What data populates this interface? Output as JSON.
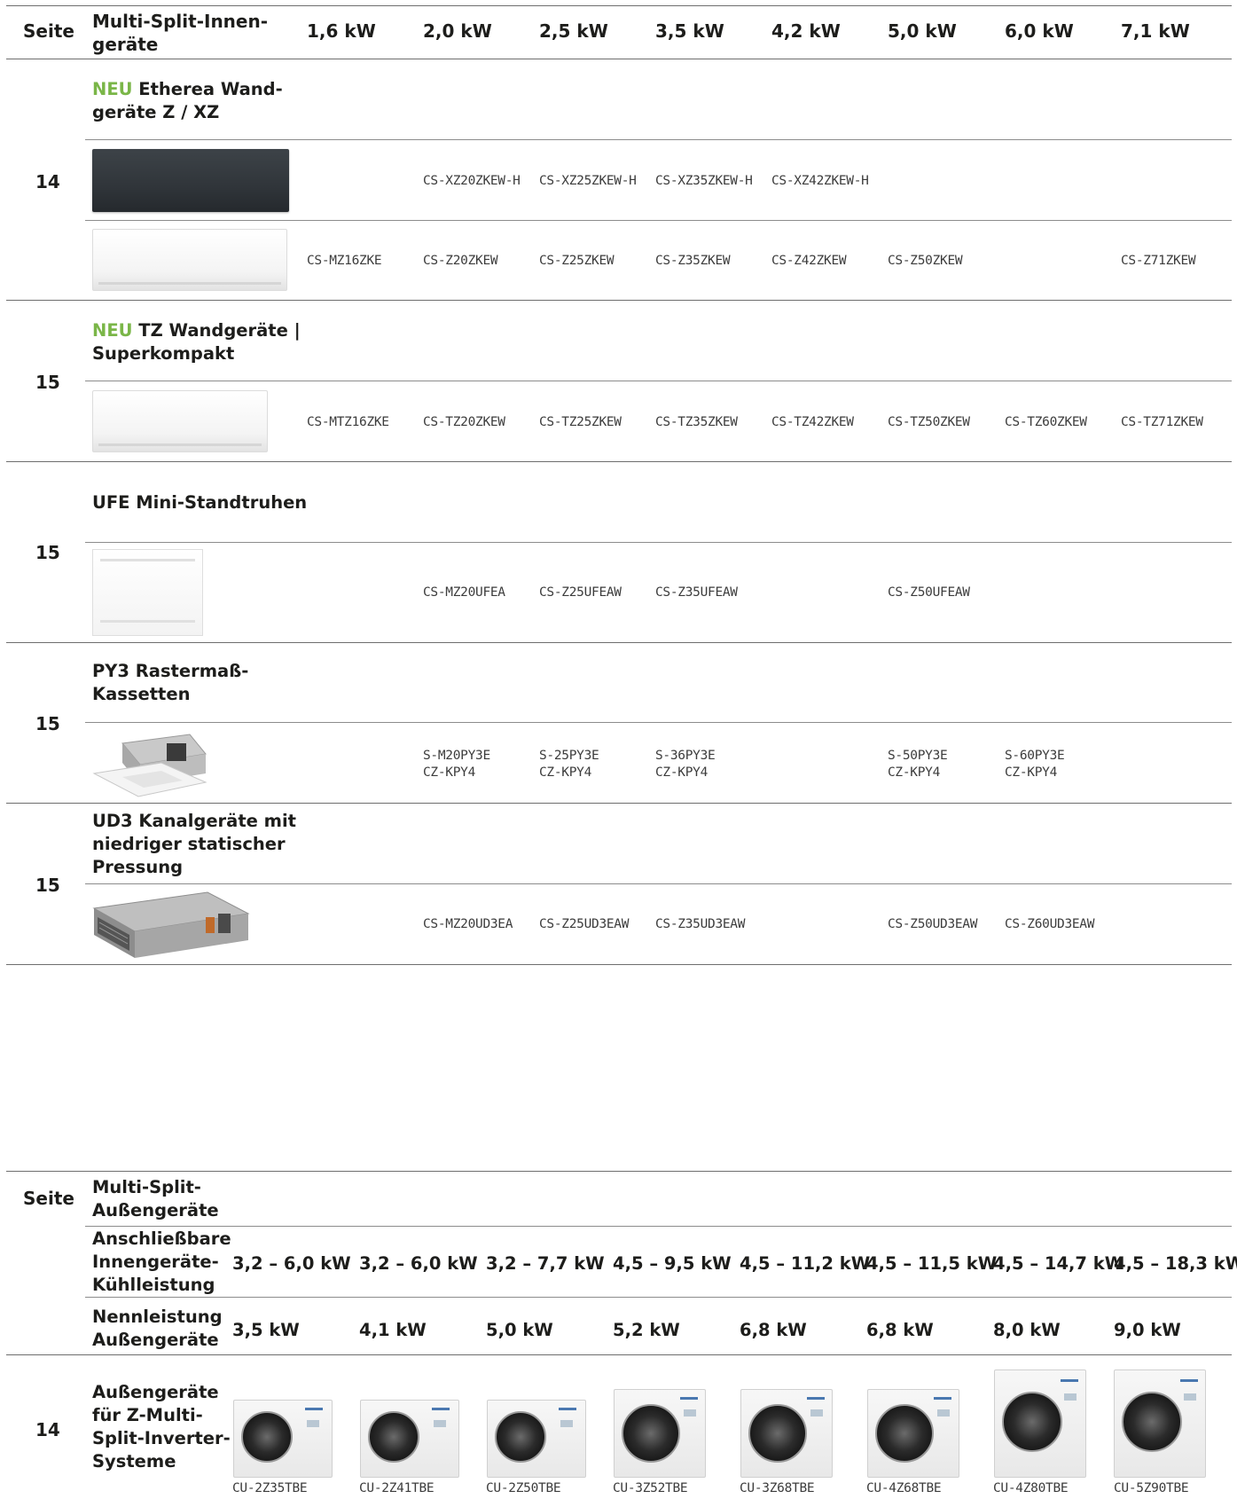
{
  "indoor_table": {
    "header": {
      "page_label": "Seite",
      "category_label": "Multi-Split-Innen-\ngeräte",
      "capacities": [
        "1,6 kW",
        "2,0 kW",
        "2,5 kW",
        "3,5 kW",
        "4,2 kW",
        "5,0 kW",
        "6,0 kW",
        "7,1 kW"
      ]
    },
    "sections": [
      {
        "page": "14",
        "neu": "NEU",
        "title_line1": " Etherea Wand-",
        "title_line2": "geräte Z / XZ",
        "rows": [
          {
            "image": "wall-unit-dark",
            "models": [
              "",
              "CS-XZ20ZKEW-H",
              "CS-XZ25ZKEW-H",
              "CS-XZ35ZKEW-H",
              "CS-XZ42ZKEW-H",
              "",
              "",
              ""
            ]
          },
          {
            "image": "wall-unit-white",
            "models": [
              "CS-MZ16ZKE",
              "CS-Z20ZKEW",
              "CS-Z25ZKEW",
              "CS-Z35ZKEW",
              "CS-Z42ZKEW",
              "CS-Z50ZKEW",
              "",
              "CS-Z71ZKEW"
            ]
          }
        ]
      },
      {
        "page": "15",
        "neu": "NEU",
        "title_line1": " TZ Wandgeräte |",
        "title_line2": "Superkompakt",
        "rows": [
          {
            "image": "wall-unit-white",
            "models": [
              "CS-MTZ16ZKE",
              "CS-TZ20ZKEW",
              "CS-TZ25ZKEW",
              "CS-TZ35ZKEW",
              "CS-TZ42ZKEW",
              "CS-TZ50ZKEW",
              "CS-TZ60ZKEW",
              "CS-TZ71ZKEW"
            ]
          }
        ]
      },
      {
        "page": "15",
        "title_line1": "UFE Mini-Standtruhen",
        "rows": [
          {
            "image": "floor-console-unit",
            "models": [
              "",
              "CS-MZ20UFEA",
              "CS-Z25UFEAW",
              "CS-Z35UFEAW",
              "",
              "CS-Z50UFEAW",
              "",
              ""
            ]
          }
        ]
      },
      {
        "page": "15",
        "title_line1": "PY3 Rastermaß-",
        "title_line2": "Kassetten",
        "rows": [
          {
            "image": "cassette-unit",
            "models": [
              "",
              "S-M20PY3E\nCZ-KPY4",
              "S-25PY3E\nCZ-KPY4",
              "S-36PY3E\nCZ-KPY4",
              "",
              "S-50PY3E\nCZ-KPY4",
              "S-60PY3E\nCZ-KPY4",
              ""
            ]
          }
        ]
      },
      {
        "page": "15",
        "title_line1": "UD3 Kanalgeräte mit",
        "title_line2": "niedriger statischer",
        "title_line3": "Pressung",
        "rows": [
          {
            "image": "duct-unit",
            "models": [
              "",
              "CS-MZ20UD3EA",
              "CS-Z25UD3EAW",
              "CS-Z35UD3EAW",
              "",
              "CS-Z50UD3EAW",
              "CS-Z60UD3EAW",
              ""
            ]
          }
        ]
      }
    ]
  },
  "outdoor_table": {
    "page_label": "Seite",
    "title": "Multi-Split-\nAußengeräte",
    "connectable_label": "Anschließbare\nInnengeräte-\nKühlleistung",
    "connectable": [
      "3,2 – 6,0 kW",
      "3,2 – 6,0 kW",
      "3,2 – 7,7 kW",
      "4,5 – 9,5 kW",
      "4,5 – 11,2 kW",
      "4,5 – 11,5 kW",
      "4,5 – 14,7 kW",
      "4,5 – 18,3 kW"
    ],
    "nominal_label": "Nennleistung\nAußengeräte",
    "nominal": [
      "3,5 kW",
      "4,1 kW",
      "5,0 kW",
      "5,2 kW",
      "6,8 kW",
      "6,8 kW",
      "8,0 kW",
      "9,0 kW"
    ],
    "section": {
      "page": "14",
      "title": "Außengeräte\nfür Z-Multi-\nSplit-Inverter-\nSysteme",
      "models": [
        "CU-2Z35TBE",
        "CU-2Z41TBE",
        "CU-2Z50TBE",
        "CU-3Z52TBE",
        "CU-3Z68TBE",
        "CU-4Z68TBE",
        "CU-4Z80TBE",
        "CU-5Z90TBE"
      ]
    }
  }
}
